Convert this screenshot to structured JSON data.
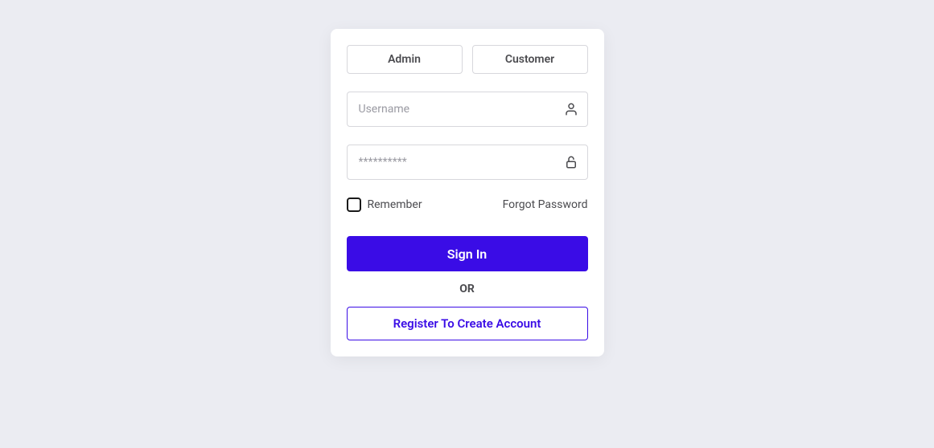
{
  "tabs": {
    "admin": "Admin",
    "customer": "Customer"
  },
  "fields": {
    "username_placeholder": "Username",
    "password_placeholder": "**********"
  },
  "options": {
    "remember_label": "Remember",
    "forgot_label": "Forgot Password"
  },
  "buttons": {
    "sign_in": "Sign In",
    "register": "Register To Create Account"
  },
  "divider": "OR"
}
